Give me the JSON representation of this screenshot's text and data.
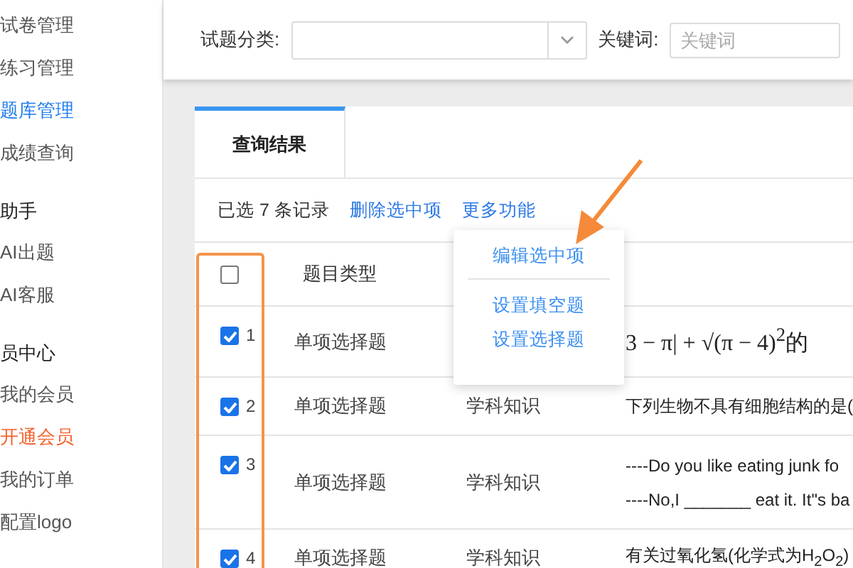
{
  "sidebar": {
    "items": [
      {
        "kind": "item",
        "label": "试卷管理",
        "selected": false,
        "highlight": false
      },
      {
        "kind": "item",
        "label": "练习管理",
        "selected": false,
        "highlight": false
      },
      {
        "kind": "item",
        "label": "题库管理",
        "selected": true,
        "highlight": false
      },
      {
        "kind": "item",
        "label": "成绩查询",
        "selected": false,
        "highlight": false
      },
      {
        "kind": "header",
        "label": "助手"
      },
      {
        "kind": "item",
        "label": "AI出题",
        "selected": false,
        "highlight": false
      },
      {
        "kind": "item",
        "label": "AI客服",
        "selected": false,
        "highlight": false
      },
      {
        "kind": "header",
        "label": "员中心"
      },
      {
        "kind": "item",
        "label": "我的会员",
        "selected": false,
        "highlight": false
      },
      {
        "kind": "item",
        "label": "开通会员",
        "selected": false,
        "highlight": true
      },
      {
        "kind": "item",
        "label": "我的订单",
        "selected": false,
        "highlight": false
      },
      {
        "kind": "item",
        "label": "配置logo",
        "selected": false,
        "highlight": false
      }
    ]
  },
  "filters": {
    "category_label": "试题分类:",
    "keyword_label": "关键词:",
    "keyword_placeholder": "关键词"
  },
  "tabs": [
    {
      "label": "查询结果",
      "selected": true
    }
  ],
  "toolbar": {
    "summary": "已选 7 条记录",
    "delete": "删除选中项",
    "more": "更多功能"
  },
  "more_menu": [
    {
      "label": "编辑选中项"
    },
    {
      "label": "设置填空题"
    },
    {
      "label": "设置选择题"
    }
  ],
  "table": {
    "select_all": {
      "checked": false
    },
    "columns": [
      "题目类型"
    ],
    "rows": [
      {
        "selected": true,
        "number": "1",
        "type": "单项选择题",
        "category": "",
        "math": true,
        "question_lines": [
          "3 − π| + √(π − 4)$^{2}$的"
        ]
      },
      {
        "selected": true,
        "number": "2",
        "type": "单项选择题",
        "category": "学科知识",
        "math": false,
        "question_lines": [
          "下列生物不具有细胞结构的是("
        ]
      },
      {
        "selected": true,
        "number": "3",
        "type": "单项选择题",
        "category": "学科知识",
        "math": false,
        "question_lines": [
          "----Do you like eating junk fo",
          "----No,I _______ eat it. It\"s ba"
        ]
      },
      {
        "selected": true,
        "number": "4",
        "type": "单项选择题",
        "category": "学科知识",
        "math": false,
        "question_lines": [
          "有关过氧化氢(化学式为H$_{2}$O$_{2}$)"
        ]
      }
    ]
  }
}
